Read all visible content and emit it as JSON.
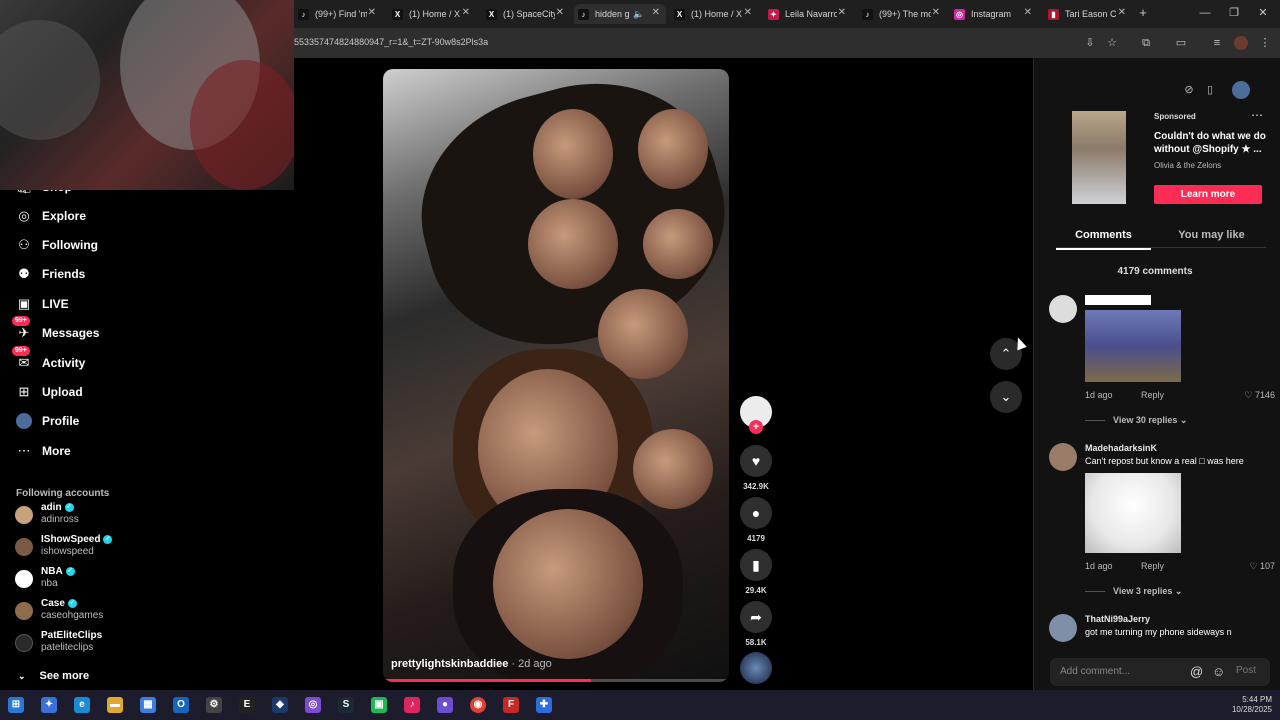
{
  "browser": {
    "tabs": [
      {
        "title": "(99+) Find 'm",
        "icon": "tiktok-icon",
        "color": "#111111"
      },
      {
        "title": "(1) Home / X",
        "icon": "x-icon",
        "color": "#111111"
      },
      {
        "title": "(1) SpaceCity",
        "icon": "x-icon",
        "color": "#111111"
      },
      {
        "title": "hidden g",
        "icon": "tiktok-icon",
        "color": "#111111",
        "active": true
      },
      {
        "title": "(1) Home / X",
        "icon": "x-icon",
        "color": "#111111"
      },
      {
        "title": "Leila Navarro",
        "icon": "app-icon",
        "color": "#c9184a"
      },
      {
        "title": "(99+) The mo",
        "icon": "tiktok-icon",
        "color": "#111111"
      },
      {
        "title": "Instagram",
        "icon": "instagram-icon",
        "color": "#d6249f"
      },
      {
        "title": "Tari Eason C",
        "icon": "news-icon",
        "color": "#b3122b"
      }
    ],
    "url": "553357474824880947_r=1&_t=ZT-90w8s2Pls3a"
  },
  "sidebar": {
    "items": [
      {
        "label": "Shop",
        "icon": "shop-icon"
      },
      {
        "label": "Explore",
        "icon": "compass-icon"
      },
      {
        "label": "Following",
        "icon": "following-icon"
      },
      {
        "label": "Friends",
        "icon": "friends-icon"
      },
      {
        "label": "LIVE",
        "icon": "live-icon"
      },
      {
        "label": "Messages",
        "icon": "messages-icon",
        "badge": "99+"
      },
      {
        "label": "Activity",
        "icon": "activity-icon",
        "badge": "99+"
      },
      {
        "label": "Upload",
        "icon": "upload-icon"
      },
      {
        "label": "Profile",
        "icon": "profile-icon"
      },
      {
        "label": "More",
        "icon": "more-icon"
      }
    ],
    "following_title": "Following accounts",
    "accounts": [
      {
        "name": "adin",
        "handle": "adinross",
        "verified": true
      },
      {
        "name": "IShowSpeed",
        "handle": "ishowspeed",
        "verified": true
      },
      {
        "name": "NBA",
        "handle": "nba",
        "verified": true
      },
      {
        "name": "Case",
        "handle": "caseohgames",
        "verified": true
      },
      {
        "name": "PatEliteClips",
        "handle": "pateliteclips",
        "verified": false
      }
    ],
    "see_more": "See more"
  },
  "video": {
    "author": "prettylightskinbaddiee",
    "date": "· 2d ago",
    "progress": 0.6
  },
  "actions": {
    "likes": "342.9K",
    "comments": "4179",
    "saves": "29.4K",
    "shares": "58.1K"
  },
  "ad": {
    "sponsored": "Sponsored",
    "text": "Couldn't do what we do without @Shopify ★ ...",
    "brand": "Olivia & the Zelons",
    "cta": "Learn more"
  },
  "panel": {
    "tab_comments": "Comments",
    "tab_like": "You may like",
    "count": "4179 comments"
  },
  "comments": [
    {
      "name": "",
      "text": "",
      "time": "1d ago",
      "reply": "Reply",
      "likes": "7146",
      "replies": "View 30 replies"
    },
    {
      "name": "MadehadarksinK",
      "text": "Can't repost but know a real □ was here",
      "time": "1d ago",
      "reply": "Reply",
      "likes": "107",
      "replies": "View 3 replies"
    },
    {
      "name": "ThatNi99aJerry",
      "text": "got me turning my phone sideways n"
    }
  ],
  "comment_input": {
    "placeholder": "Add comment...",
    "post": "Post"
  },
  "clock": {
    "time": "5:44 PM",
    "date": "10/28/2025"
  }
}
